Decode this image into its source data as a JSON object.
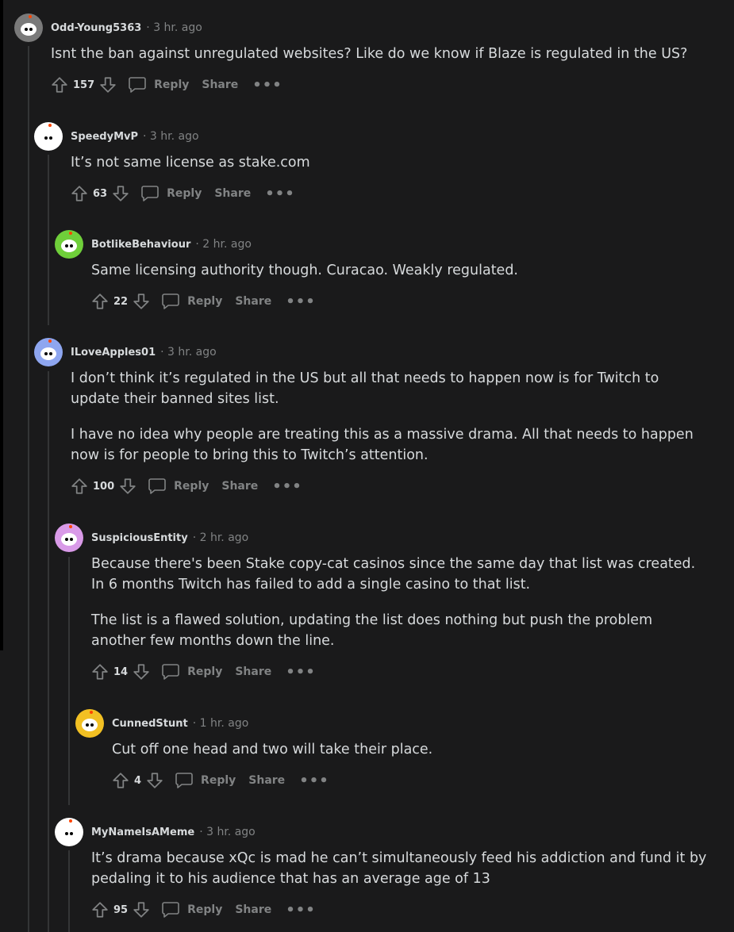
{
  "labels": {
    "reply": "Reply",
    "share": "Share",
    "more": "•••"
  },
  "comments": [
    {
      "username": "Odd-Young5363",
      "time": "· 3 hr. ago",
      "votes": "157",
      "avatar_color": "#7a7a7a",
      "paragraphs": [
        "Isnt the ban against unregulated websites? Like do we know if Blaze is regulated in the US?"
      ]
    },
    {
      "username": "SpeedyMvP",
      "time": "· 3 hr. ago",
      "votes": "63",
      "avatar_color": "#ffffff",
      "paragraphs": [
        "It’s not same license as stake.com"
      ]
    },
    {
      "username": "BotlikeBehaviour",
      "time": "· 2 hr. ago",
      "votes": "22",
      "avatar_color": "#6fcf3a",
      "paragraphs": [
        "Same licensing authority though. Curacao. Weakly regulated."
      ]
    },
    {
      "username": "ILoveApples01",
      "time": "· 3 hr. ago",
      "votes": "100",
      "avatar_color": "#8ea6f0",
      "paragraphs": [
        "I don’t think it’s regulated in the US but all that needs to happen now is for Twitch to update their banned sites list.",
        "I have no idea why people are treating this as a massive drama. All that needs to happen now is for people to bring this to Twitch’s attention."
      ]
    },
    {
      "username": "SuspiciousEntity",
      "time": "· 2 hr. ago",
      "votes": "14",
      "avatar_color": "#d99ae8",
      "paragraphs": [
        "Because there's been Stake copy-cat casinos since the same day that list was created. In 6 months Twitch has failed to add a single casino to that list.",
        "The list is a flawed solution, updating the list does nothing but push the problem another few months down the line."
      ]
    },
    {
      "username": "CunnedStunt",
      "time": "· 1 hr. ago",
      "votes": "4",
      "avatar_color": "#f2c023",
      "paragraphs": [
        "Cut off one head and two will take their place."
      ]
    },
    {
      "username": "MyNameIsAMeme",
      "time": "· 3 hr. ago",
      "votes": "95",
      "avatar_color": "#ffffff",
      "paragraphs": [
        "It’s drama because xQc is mad he can’t simultaneously feed his addiction and fund it by pedaling it to his audience that has an average age of 13"
      ]
    }
  ]
}
